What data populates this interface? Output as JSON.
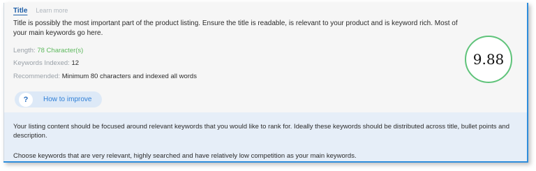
{
  "header": {
    "title": "Title",
    "learn_more": "Learn more"
  },
  "description": "Title is possibly the most important part of the product listing. Ensure the title is readable, is relevant to your product and is keyword rich. Most of your main keywords go here.",
  "stats": {
    "length_label": "Length:",
    "length_value": "78 Character(s)",
    "indexed_label": "Keywords Indexed:",
    "indexed_value": "12",
    "recommended_label": "Recommended:",
    "recommended_value": "Minimum 80 characters and indexed all words"
  },
  "improve_button": {
    "icon": "?",
    "label": "How to improve"
  },
  "score": {
    "value": "9.88",
    "ring_color": "#5fc37a"
  },
  "tips": [
    "Your listing content should be focused around relevant keywords that you would like to rank for. Ideally these keywords should be distributed across title, bullet points and description.",
    "Choose keywords that are very relevant, highly searched and have relatively low competition as your main keywords."
  ],
  "colors": {
    "accent": "#2f8ddb",
    "title": "#1f5fa8",
    "good": "#5cb85c",
    "tips_bg": "#e6eef8"
  }
}
